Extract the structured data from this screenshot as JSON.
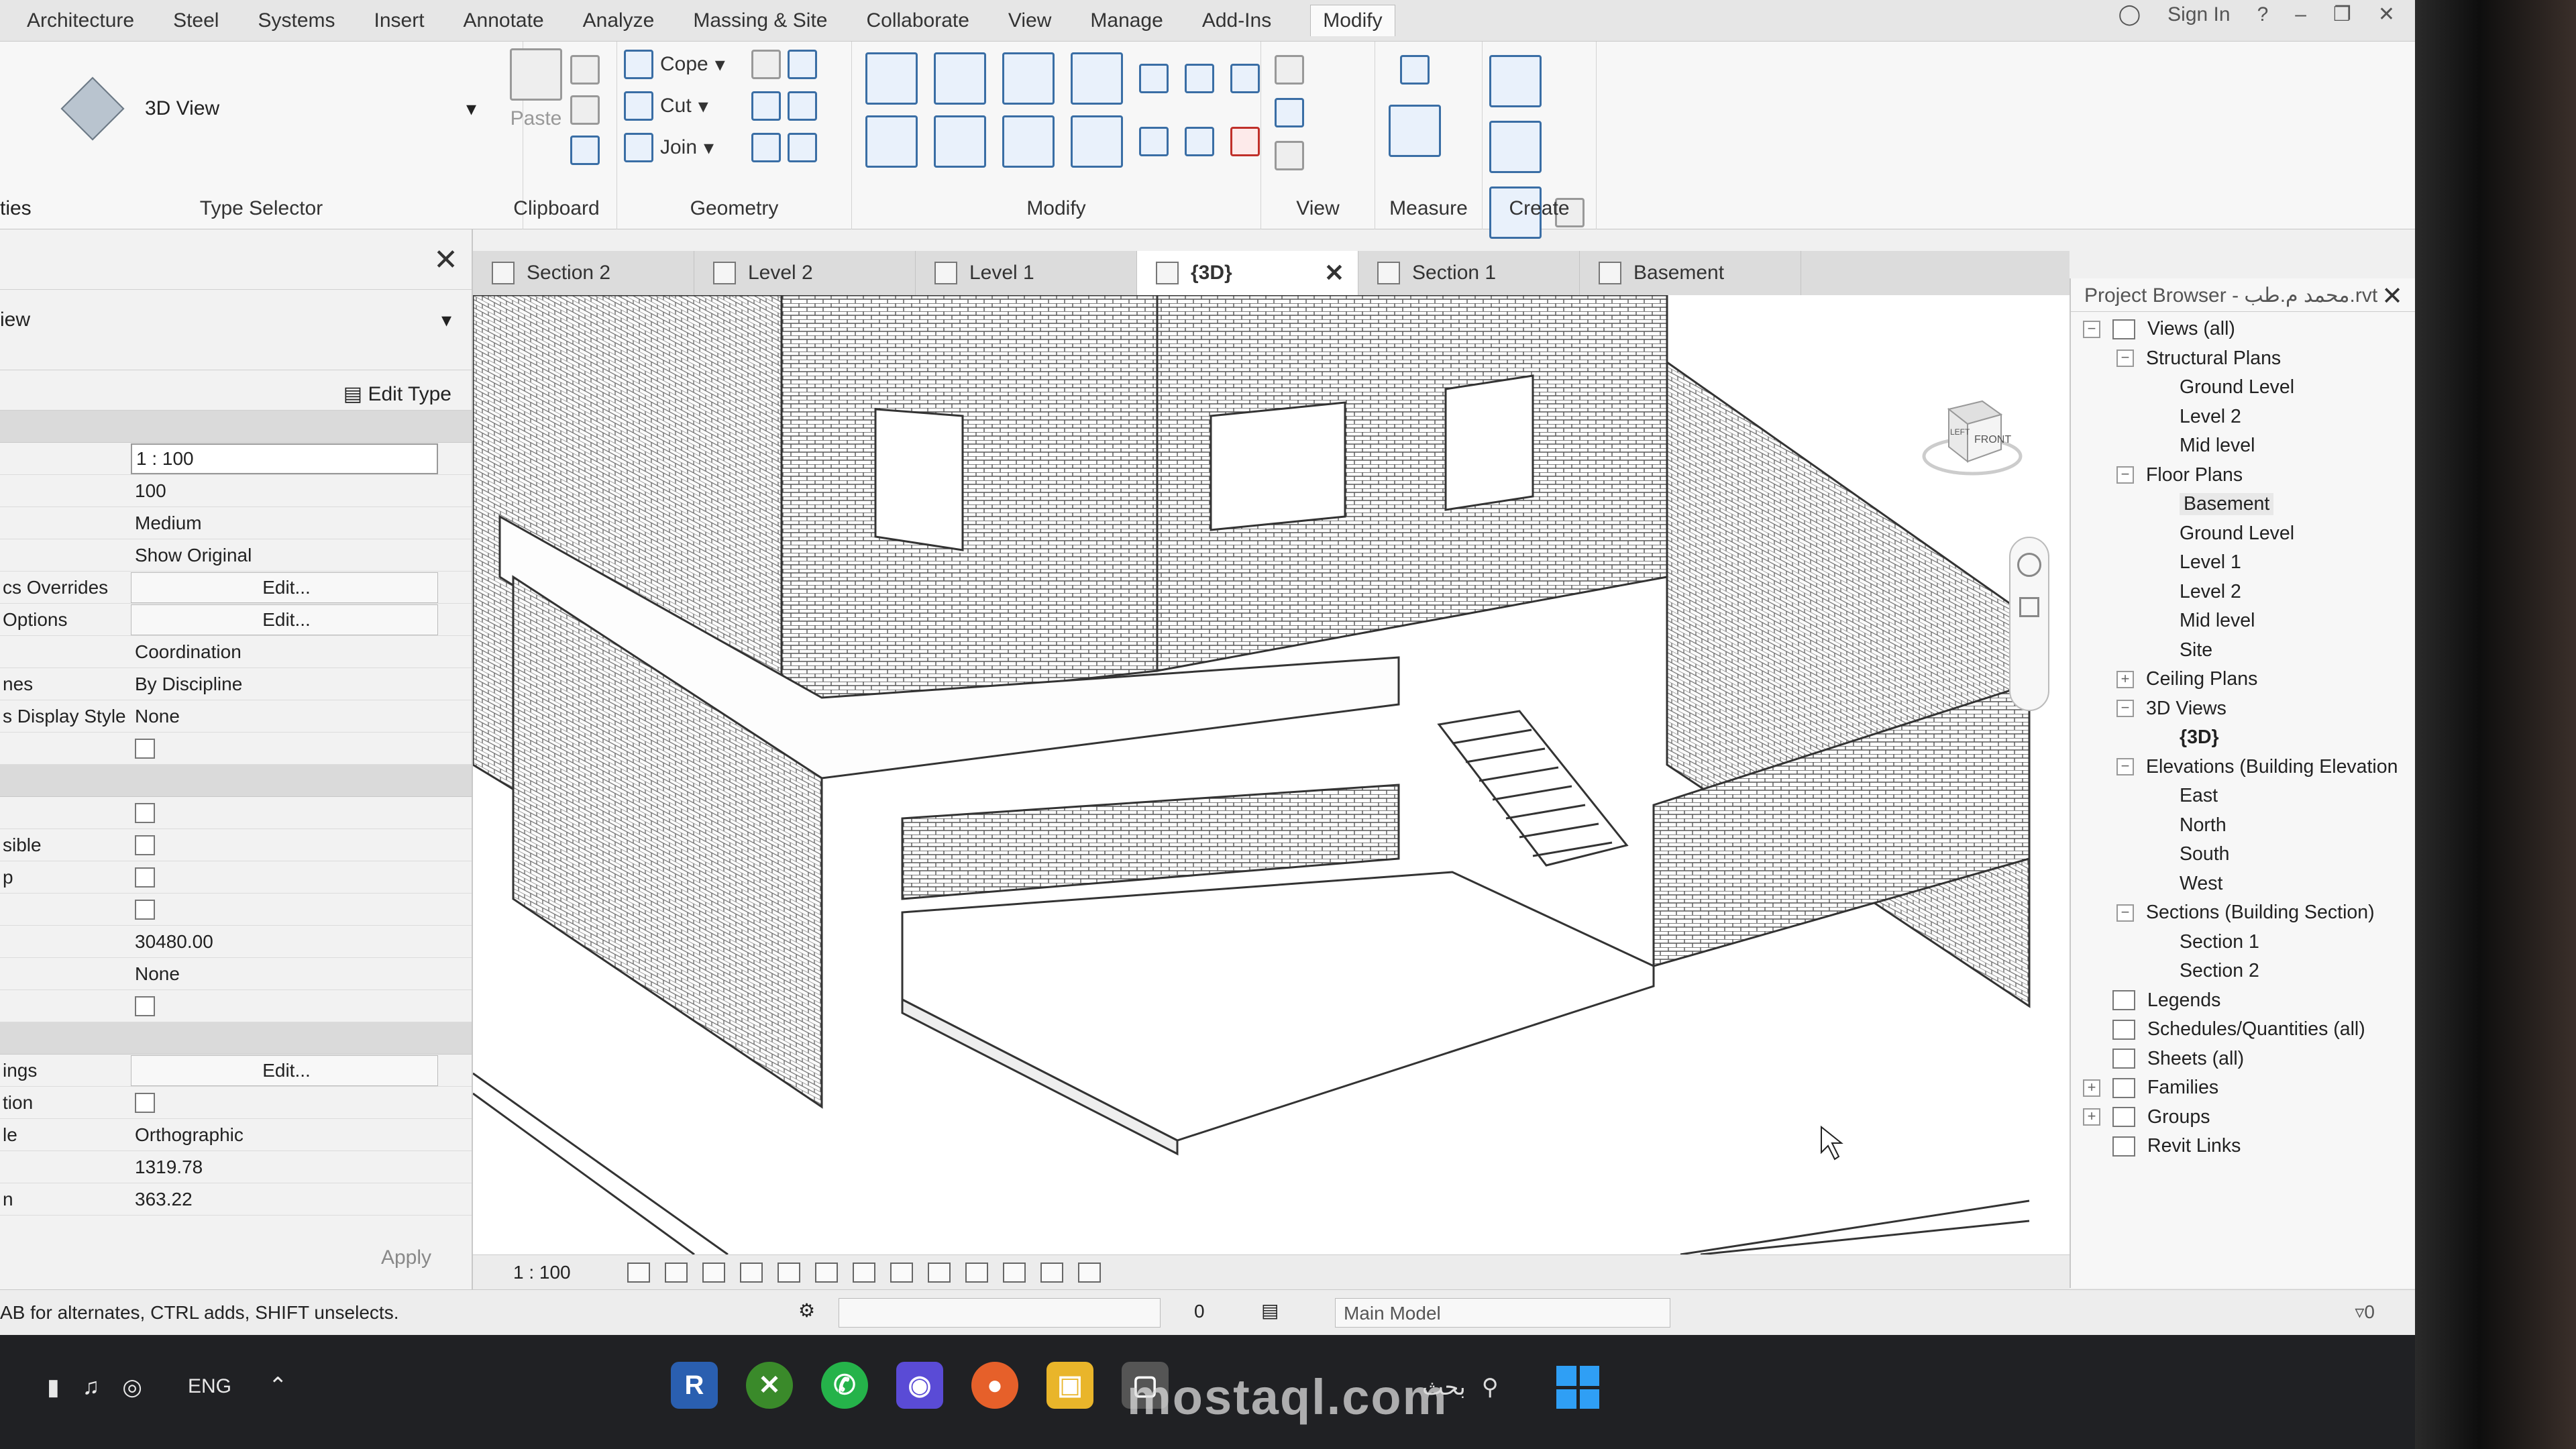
{
  "ribbon_tabs": [
    "Architecture",
    "Steel",
    "Systems",
    "Insert",
    "Annotate",
    "Analyze",
    "Massing & Site",
    "Collaborate",
    "View",
    "Manage",
    "Add-Ins",
    "Modify"
  ],
  "active_tab": "Modify",
  "titlebar": {
    "sign_in": "Sign In"
  },
  "ribbon": {
    "type_selector_value": "3D View",
    "type_selector_label": "Type Selector",
    "properties_label_fragment": "ties",
    "clipboard": {
      "paste": "Paste",
      "label": "Clipboard"
    },
    "geometry": {
      "cope": "Cope",
      "cut": "Cut",
      "join": "Join",
      "label": "Geometry"
    },
    "modify_label": "Modify",
    "view_label": "View",
    "measure_label": "Measure",
    "create_label": "Create"
  },
  "properties": {
    "view_fragment": "iew",
    "edit_type": "Edit Type",
    "rows": [
      {
        "k": "",
        "v": "1 : 100",
        "style": "box"
      },
      {
        "k": "",
        "v": "100",
        "style": ""
      },
      {
        "k": "",
        "v": "Medium",
        "style": ""
      },
      {
        "k": "",
        "v": "Show Original",
        "style": ""
      },
      {
        "k": "cs Overrides",
        "v": "Edit...",
        "style": "btn"
      },
      {
        "k": "Options",
        "v": "Edit...",
        "style": "btn"
      },
      {
        "k": "",
        "v": "Coordination",
        "style": ""
      },
      {
        "k": "nes",
        "v": "By Discipline",
        "style": ""
      },
      {
        "k": "s Display Style",
        "v": "None",
        "style": ""
      },
      {
        "k": "",
        "v": "",
        "style": "chk"
      }
    ],
    "rows2": [
      {
        "k": "",
        "v": "",
        "style": "chk"
      },
      {
        "k": "sible",
        "v": "",
        "style": "chk"
      },
      {
        "k": "p",
        "v": "",
        "style": "chk"
      },
      {
        "k": "",
        "v": "",
        "style": "chk"
      },
      {
        "k": "",
        "v": "30480.00",
        "style": ""
      },
      {
        "k": "",
        "v": "None",
        "style": ""
      },
      {
        "k": "",
        "v": "",
        "style": "chk"
      }
    ],
    "rows3": [
      {
        "k": "ings",
        "v": "Edit...",
        "style": "btn"
      },
      {
        "k": "tion",
        "v": "",
        "style": "chk"
      },
      {
        "k": "le",
        "v": "Orthographic",
        "style": ""
      },
      {
        "k": "",
        "v": "1319.78",
        "style": ""
      },
      {
        "k": "n",
        "v": "363.22",
        "style": ""
      }
    ],
    "apply": "Apply"
  },
  "view_tabs": [
    {
      "label": "Section 2",
      "active": false
    },
    {
      "label": "Level 2",
      "active": false
    },
    {
      "label": "Level 1",
      "active": false
    },
    {
      "label": "{3D}",
      "active": true
    },
    {
      "label": "Section 1",
      "active": false
    },
    {
      "label": "Basement",
      "active": false
    }
  ],
  "viewcube": {
    "front": "FRONT",
    "left": "LEFT"
  },
  "view_control": {
    "scale": "1 : 100"
  },
  "project_browser": {
    "title": "Project Browser - محمد م.طب.rvt",
    "tree": [
      {
        "label": "Views (all)",
        "depth": 0,
        "exp": "-",
        "icon": true
      },
      {
        "label": "Structural Plans",
        "depth": 1,
        "exp": "-"
      },
      {
        "label": "Ground Level",
        "depth": 2
      },
      {
        "label": "Level 2",
        "depth": 2
      },
      {
        "label": "Mid level",
        "depth": 2
      },
      {
        "label": "Floor Plans",
        "depth": 1,
        "exp": "-"
      },
      {
        "label": "Basement",
        "depth": 2,
        "hl": true
      },
      {
        "label": "Ground Level",
        "depth": 2
      },
      {
        "label": "Level 1",
        "depth": 2
      },
      {
        "label": "Level 2",
        "depth": 2
      },
      {
        "label": "Mid level",
        "depth": 2
      },
      {
        "label": "Site",
        "depth": 2
      },
      {
        "label": "Ceiling Plans",
        "depth": 1,
        "exp": "+"
      },
      {
        "label": "3D Views",
        "depth": 1,
        "exp": "-"
      },
      {
        "label": "{3D}",
        "depth": 2,
        "sel": true
      },
      {
        "label": "Elevations (Building Elevation",
        "depth": 1,
        "exp": "-"
      },
      {
        "label": "East",
        "depth": 2
      },
      {
        "label": "North",
        "depth": 2
      },
      {
        "label": "South",
        "depth": 2
      },
      {
        "label": "West",
        "depth": 2
      },
      {
        "label": "Sections (Building Section)",
        "depth": 1,
        "exp": "-"
      },
      {
        "label": "Section 1",
        "depth": 2
      },
      {
        "label": "Section 2",
        "depth": 2
      },
      {
        "label": "Legends",
        "depth": 0,
        "icon": true
      },
      {
        "label": "Schedules/Quantities (all)",
        "depth": 0,
        "icon": true
      },
      {
        "label": "Sheets (all)",
        "depth": 0,
        "icon": true
      },
      {
        "label": "Families",
        "depth": 0,
        "exp": "+",
        "icon": true
      },
      {
        "label": "Groups",
        "depth": 0,
        "exp": "+",
        "icon": true
      },
      {
        "label": "Revit Links",
        "depth": 0,
        "icon": true
      }
    ]
  },
  "status": {
    "hint": "AB for alternates, CTRL adds, SHIFT unselects.",
    "workset_value": "0",
    "model": "Main Model",
    "filter_count": "0"
  },
  "taskbar": {
    "lang": "ENG",
    "search_text": "بحث",
    "revit_letter": "R"
  },
  "watermark": "mostaql.com",
  "colors": {
    "accent": "#3a6ea5",
    "taskbar": "#202124",
    "windows_blue": "#2f9ff5"
  }
}
